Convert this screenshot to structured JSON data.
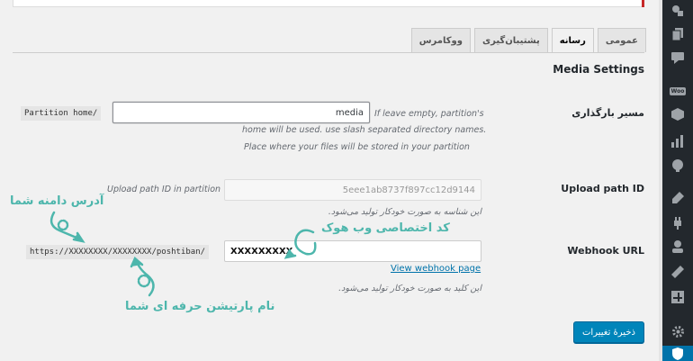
{
  "tabs": [
    {
      "label": "عمومی",
      "active": false
    },
    {
      "label": "رسانه",
      "active": true
    },
    {
      "label": "پشتیبان‌گیری",
      "active": false
    },
    {
      "label": "ووکامرس",
      "active": false
    }
  ],
  "page_title": "Media Settings",
  "upload_path": {
    "label": "مسیر بارگذاری",
    "prefix": "Partition home/",
    "value": "media",
    "desc_line1": "If leave empty, partition's",
    "desc_line2": "home will be used. use slash separated directory names.",
    "desc_line3": "Place where your files will be stored in your partition"
  },
  "upload_path_id": {
    "label": "Upload path ID",
    "field_label": "Upload path ID in partition",
    "value": "5eee1ab8737f897cc12d9144",
    "desc": "این شناسه به صورت خودکار تولید می‌شود."
  },
  "webhook": {
    "label": "Webhook URL",
    "prefix": "https://XXXXXXXX/XXXXXXXX/poshtiban/",
    "value": "XXXXXXXXX",
    "link": "View webhook page",
    "desc": "این کلید به صورت خودکار تولید می‌شود."
  },
  "save_label": "ذخیرهٔ تغییرات",
  "annotations": {
    "domain": "آدرس دامنه شما",
    "webhook_code": "کد اختصاصی وب هوک",
    "partition": "نام پارتیشن حرفه ای شما"
  },
  "sidebar_icons": [
    "wordpress-icon",
    "pages-icon",
    "comments-icon",
    "woocommerce-icon",
    "products-icon",
    "analytics-icon",
    "marketing-icon",
    "appearance-icon",
    "plugins-icon",
    "users-icon",
    "tools-icon",
    "settings-icon",
    "poshtiban-settings-icon",
    "shield-icon"
  ],
  "colors": {
    "accent": "#0085ba",
    "annotation": "#4db6ac",
    "sidebar": "#23282d",
    "active": "#0073aa"
  }
}
